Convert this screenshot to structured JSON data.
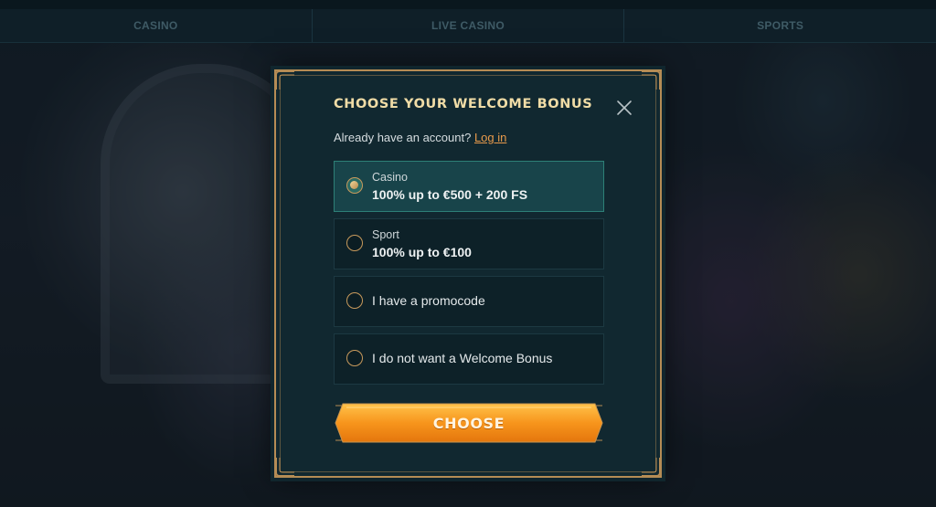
{
  "nav": {
    "items": [
      {
        "label": "CASINO"
      },
      {
        "label": "LIVE CASINO"
      },
      {
        "label": "SPORTS"
      }
    ]
  },
  "modal": {
    "title": "CHOOSE YOUR WELCOME BONUS",
    "close_icon": "close-x",
    "account_prompt": "Already have an account?",
    "login_link": "Log in",
    "options": [
      {
        "sub": "Casino",
        "main": "100% up to €500 + 200 FS",
        "selected": true
      },
      {
        "sub": "Sport",
        "main": "100% up to €100",
        "selected": false
      },
      {
        "main": "I have a promocode",
        "selected": false
      },
      {
        "main": "I do not want a Welcome Bonus",
        "selected": false
      }
    ],
    "choose_button": "CHOOSE"
  },
  "colors": {
    "accent_gold": "#b58c55",
    "button_orange": "#f59a1b",
    "link_orange": "#e79a4b",
    "modal_bg": "#112830",
    "selected_bg": "#18444a"
  }
}
